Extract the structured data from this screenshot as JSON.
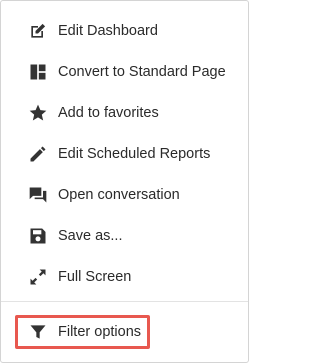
{
  "menu": {
    "items": [
      {
        "id": "edit-dashboard",
        "label": "Edit Dashboard",
        "icon": "edit-square-icon"
      },
      {
        "id": "convert-standard-page",
        "label": "Convert to Standard Page",
        "icon": "dashboard-layout-icon"
      },
      {
        "id": "add-favorites",
        "label": "Add to favorites",
        "icon": "star-icon"
      },
      {
        "id": "edit-scheduled-reports",
        "label": "Edit Scheduled Reports",
        "icon": "pencil-icon"
      },
      {
        "id": "open-conversation",
        "label": "Open conversation",
        "icon": "chat-bubbles-icon"
      },
      {
        "id": "save-as",
        "label": "Save as...",
        "icon": "save-floppy-icon"
      },
      {
        "id": "full-screen",
        "label": "Full Screen",
        "icon": "expand-arrows-icon"
      }
    ],
    "footer_item": {
      "id": "filter-options",
      "label": "Filter options",
      "icon": "filter-funnel-icon"
    }
  },
  "colors": {
    "text": "#2a2a2a",
    "icon": "#333333",
    "border": "#d4d4d4",
    "highlight": "#e8584f"
  }
}
